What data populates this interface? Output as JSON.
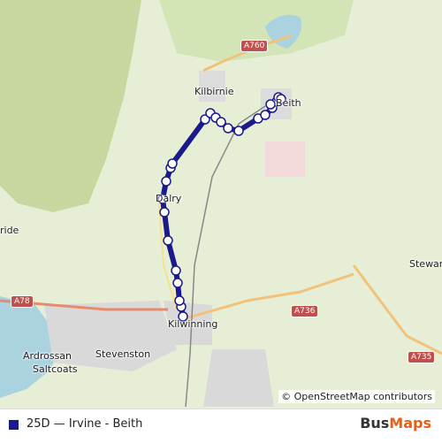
{
  "map": {
    "places": [
      {
        "name": "Kilbirnie"
      },
      {
        "name": "Beith"
      },
      {
        "name": "Dalry"
      },
      {
        "name": "Kilwinning"
      },
      {
        "name": "Stevenston"
      },
      {
        "name": "Ardrossan"
      },
      {
        "name": "Saltcoats"
      },
      {
        "name": "Stewart"
      },
      {
        "name": "ride"
      }
    ],
    "road_labels": [
      "A760",
      "A78",
      "A736",
      "A735"
    ],
    "route": {
      "color": "#1a1a8c",
      "stop_fill": "#ffffff"
    }
  },
  "attribution": "© OpenStreetMap contributors",
  "legend": {
    "route_label": "25D — Irvine - Beith",
    "color": "#1a1a8c"
  },
  "brand": {
    "part1": "Bus",
    "part2": "Maps"
  }
}
